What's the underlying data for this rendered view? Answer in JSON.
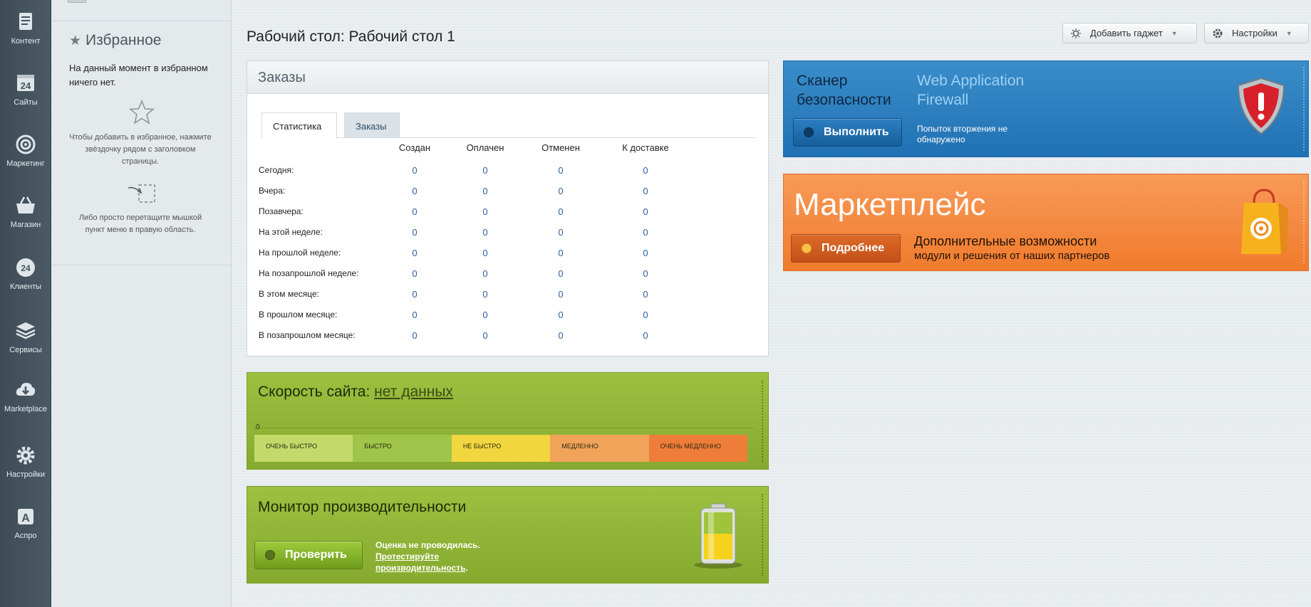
{
  "left_menu": [
    {
      "label": "Контент",
      "icon": "content-icon"
    },
    {
      "label": "Сайты",
      "icon": "sites-icon"
    },
    {
      "label": "Маркетинг",
      "icon": "marketing-icon"
    },
    {
      "label": "Магазин",
      "icon": "shop-icon"
    },
    {
      "label": "Клиенты",
      "icon": "clients-icon"
    },
    {
      "label": "Сервисы",
      "icon": "services-icon"
    },
    {
      "label": "Marketplace",
      "icon": "marketplace-icon"
    },
    {
      "label": "Настройки",
      "icon": "settings-icon"
    },
    {
      "label": "Аспро",
      "icon": "aspro-icon"
    }
  ],
  "favorites": {
    "title": "Избранное",
    "empty_text": "На данный момент в избранном ничего нет.",
    "hint_star": "Чтобы добавить в избранное, нажмите звёздочку рядом с заголовком страницы.",
    "hint_drag": "Либо просто перетащите мышкой пункт меню в правую область."
  },
  "header": {
    "title": "Рабочий стол: Рабочий стол 1",
    "add_gadget": "Добавить гаджет",
    "settings": "Настройки"
  },
  "orders": {
    "title": "Заказы",
    "tabs": [
      "Статистика",
      "Заказы"
    ],
    "columns": [
      "Создан",
      "Оплачен",
      "Отменен",
      "К доставке"
    ],
    "rows": [
      {
        "label": "Сегодня:",
        "values": [
          "0",
          "0",
          "0",
          "0"
        ]
      },
      {
        "label": "Вчера:",
        "values": [
          "0",
          "0",
          "0",
          "0"
        ]
      },
      {
        "label": "Позавчера:",
        "values": [
          "0",
          "0",
          "0",
          "0"
        ]
      },
      {
        "label": "На этой неделе:",
        "values": [
          "0",
          "0",
          "0",
          "0"
        ]
      },
      {
        "label": "На прошлой неделе:",
        "values": [
          "0",
          "0",
          "0",
          "0"
        ]
      },
      {
        "label": "На позапрошлой неделе:",
        "values": [
          "0",
          "0",
          "0",
          "0"
        ]
      },
      {
        "label": "В этом месяце:",
        "values": [
          "0",
          "0",
          "0",
          "0"
        ]
      },
      {
        "label": "В прошлом месяце:",
        "values": [
          "0",
          "0",
          "0",
          "0"
        ]
      },
      {
        "label": "В позапрошлом месяце:",
        "values": [
          "0",
          "0",
          "0",
          "0"
        ]
      }
    ]
  },
  "speed": {
    "title": "Скорость сайта:",
    "value": "нет данных",
    "scale_zero": "0",
    "segments": [
      {
        "label": "ОЧЕНЬ БЫСТРО",
        "color": "#c3da6b"
      },
      {
        "label": "БЫСТРО",
        "color": "#9fc54a"
      },
      {
        "label": "НЕ БЫСТРО",
        "color": "#f1d640"
      },
      {
        "label": "МЕДЛЕННО",
        "color": "#f2a35a"
      },
      {
        "label": "ОЧЕНЬ МЕДЛЕННО",
        "color": "#ee7d3a"
      }
    ]
  },
  "perf": {
    "title": "Монитор производительности",
    "button": "Проверить",
    "note_prefix": "Оценка не проводилась.",
    "note_link": "Протестируйте производительность",
    "note_suffix": "."
  },
  "scanner": {
    "title": "Сканер безопасности",
    "subtitle": "Web Application Firewall",
    "button": "Выполнить",
    "note": "Попыток вторжения не обнаружено"
  },
  "marketplace": {
    "title": "Маркетплейс",
    "button": "Подробнее",
    "note1": "Дополнительные возможности",
    "note2": "модули и решения от наших партнеров"
  },
  "colors": {
    "menu_bg": "#44535e",
    "link": "#2c5e9e",
    "green_gadget": "#93b838",
    "blue_gadget": "#2d80c0",
    "orange_gadget": "#f48a42"
  }
}
